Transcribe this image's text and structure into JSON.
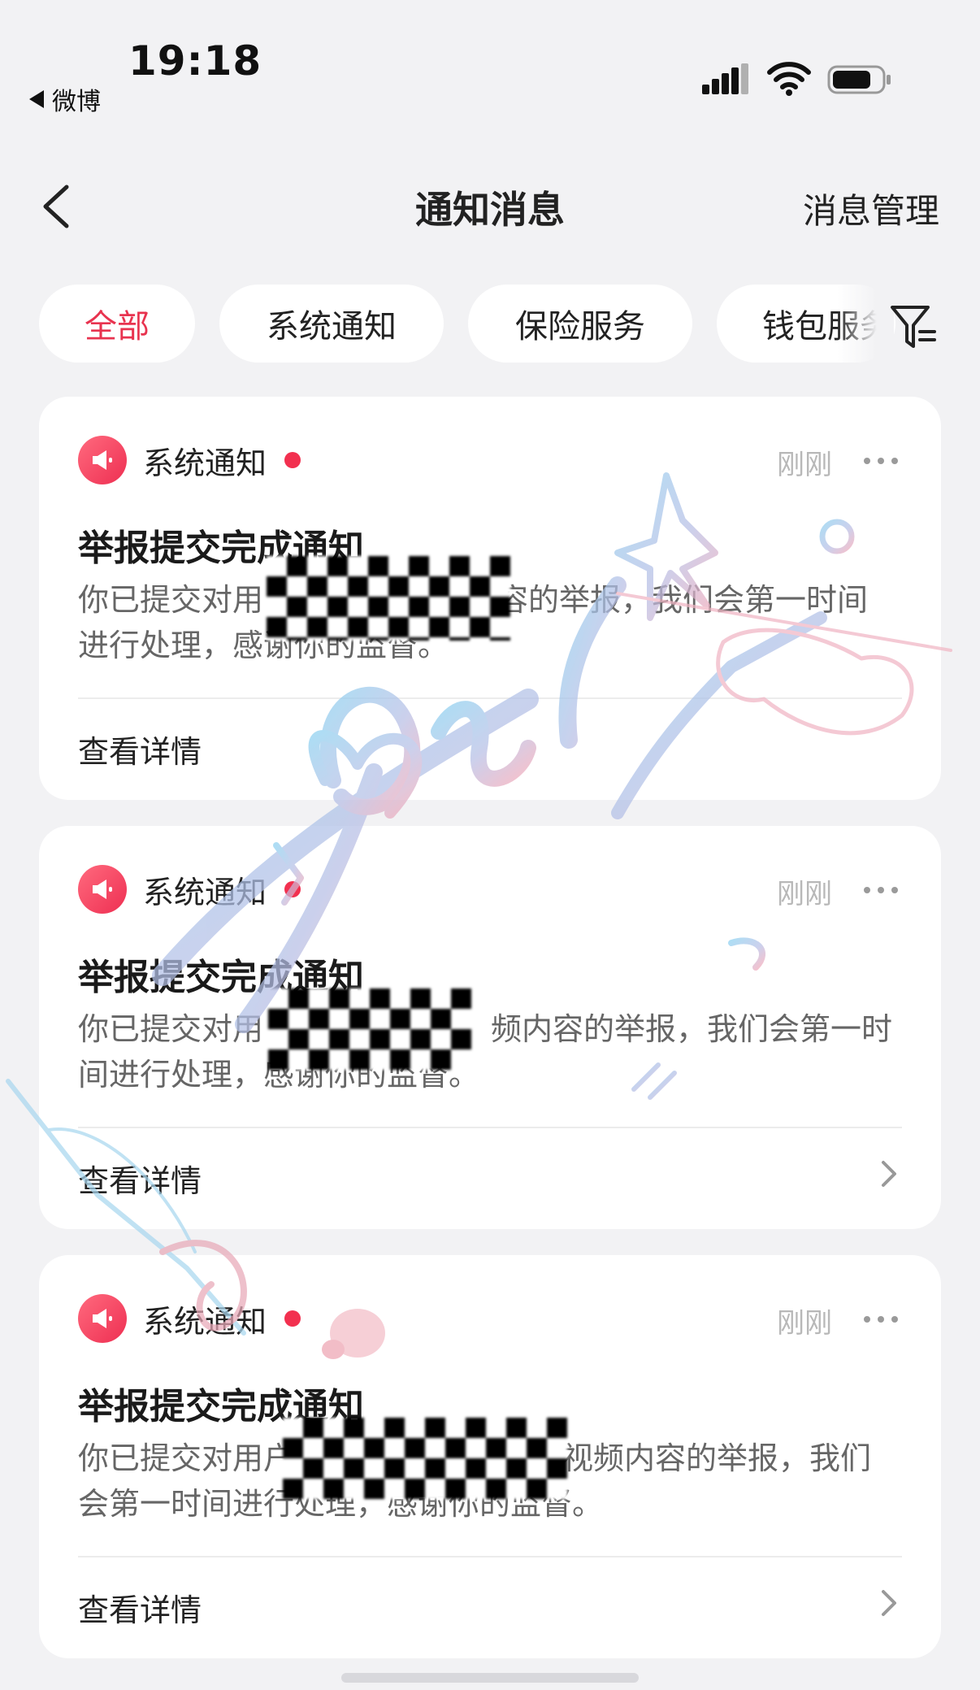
{
  "status_bar": {
    "time": "19:18",
    "back_app": "微博"
  },
  "nav": {
    "title": "通知消息",
    "manage": "消息管理"
  },
  "tabs": [
    {
      "label": "全部",
      "active": true
    },
    {
      "label": "系统通知",
      "active": false
    },
    {
      "label": "保险服务",
      "active": false
    },
    {
      "label": "钱包服务",
      "active": false
    }
  ],
  "notifications": [
    {
      "category": "系统通知",
      "time": "刚刚",
      "title": "举报提交完成通知",
      "body_prefix": "你已提交对用",
      "body_suffix": "内容的举报，我们会第一时间进行处理，感谢你的监督。",
      "action": "查看详情"
    },
    {
      "category": "系统通知",
      "time": "刚刚",
      "title": "举报提交完成通知",
      "body_prefix": "你已提交对用",
      "body_suffix": "频内容的举报，我们会第一时间进行处理，感谢你的监督。",
      "action": "查看详情"
    },
    {
      "category": "系统通知",
      "time": "刚刚",
      "title": "举报提交完成通知",
      "body_prefix": "你已提交对用户",
      "body_suffix": "视频内容的举报，我们会第一时间进行处理，感谢你的监督。",
      "action": "查看详情"
    }
  ],
  "watermark": "Xbihl",
  "colors": {
    "accent": "#e8334f",
    "unread": "#f2304f",
    "background": "#f2f2f4",
    "card": "#ffffff",
    "muted": "#b8b8b8"
  }
}
